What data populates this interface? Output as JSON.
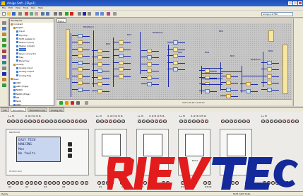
{
  "window": {
    "title": "Amigo Soft - [Elgo1]",
    "controls": [
      "_",
      "□",
      "×"
    ]
  },
  "menu": [
    "File",
    "Edit",
    "View",
    "Tools",
    "Run",
    "Help"
  ],
  "toolbar": {
    "combo_value": "Amigo-12 FBD"
  },
  "tree": {
    "header": "Workspace",
    "items": [
      {
        "label": "Constant",
        "level": 0,
        "color": "#c08a2a"
      },
      {
        "label": "Digital",
        "level": 1,
        "color": "#c08a2a"
      },
      {
        "label": "Input",
        "level": 2,
        "color": "#3f7ad0"
      },
      {
        "label": "Flip flop",
        "level": 2,
        "color": "#3f7ad0"
      },
      {
        "label": "Shift register In",
        "level": 2,
        "color": "#3f7ad0"
      },
      {
        "label": "Status 0 (low)",
        "level": 2,
        "color": "#3f7ad0"
      },
      {
        "label": "Status 1 (high)",
        "level": 2,
        "color": "#3f7ad0"
      },
      {
        "label": "Output",
        "level": 2,
        "color": "#3f7ad0"
      },
      {
        "label": "Open connector",
        "level": 2,
        "color": "#3f7ad0"
      },
      {
        "label": "Flag",
        "level": 2,
        "color": "#3f7ad0"
      },
      {
        "label": "Panel Key",
        "level": 2,
        "color": "#3f7ad0"
      },
      {
        "label": "Analog",
        "level": 1,
        "color": "#c08a2a"
      },
      {
        "label": "Analog input",
        "level": 2,
        "color": "#3f7ad0"
      },
      {
        "label": "Analog output",
        "level": 2,
        "color": "#3f7ad0"
      },
      {
        "label": "Analog flag",
        "level": 2,
        "color": "#3f7ad0"
      },
      {
        "label": "Basic",
        "level": 0,
        "color": "#c08a2a"
      },
      {
        "label": "AND",
        "level": 1,
        "color": "#3f7ad0"
      },
      {
        "label": "AND (Edge)",
        "level": 1,
        "color": "#3f7ad0"
      },
      {
        "label": "NAND",
        "level": 1,
        "color": "#3f7ad0"
      },
      {
        "label": "NAND (Edge)",
        "level": 1,
        "color": "#3f7ad0"
      },
      {
        "label": "OR",
        "level": 1,
        "color": "#3f7ad0"
      },
      {
        "label": "NOR",
        "level": 1,
        "color": "#3f7ad0"
      },
      {
        "label": "XOR",
        "level": 1,
        "color": "#3f7ad0"
      }
    ],
    "selected_index": 7
  },
  "document": {
    "tab": "Elgo1"
  },
  "diagram": {
    "labels": [
      "B001(Block)",
      "B002",
      "B003",
      "B004(Block)",
      "B005",
      "B006",
      "B007",
      "B008(Block)",
      "B009",
      "B010"
    ],
    "io_labels": [
      "I1",
      "I2",
      "I3",
      "I4",
      "Q1",
      "Q2",
      "Q3",
      "Q4"
    ]
  },
  "simbar": {
    "time_text": "2013-09-18 11:06:51"
  },
  "bottom_tabs": [
    "Info",
    "Simulation",
    "Simulation (AI)",
    "Analog (AI)"
  ],
  "simulation": {
    "cpu_brand": "RIEVTECH",
    "lcd_lines": [
      "EASY TECH",
      "NANJING",
      "Mon",
      "No faults"
    ],
    "cpu_model": "PR-18DC-DA-R",
    "ext_modules": [
      "Ext 1",
      "Ext 2",
      "Ext 3",
      "Ext 4"
    ],
    "top_io_labels": [
      "L+ M",
      "I1 I2 I3 I4 I5 I6",
      "L+ M",
      "I1 I2 I3 I4 I5 I6",
      "L+ M",
      "I1 I2 I3 I4 I5 I6",
      "L+ M",
      "I1 I2 I3 I4 I5 I6",
      "L+ M"
    ],
    "bottom_io_labels": [
      "Q1",
      "Q2",
      "Q3",
      "Q4",
      "Q1",
      "Q2",
      "Q3",
      "Q4",
      "Q1 Q2",
      "Q3 Q4"
    ]
  },
  "status": {
    "left": "Ready",
    "right": "NUM  CAPS  SCRL"
  },
  "logo": {
    "text": "RIEVTECH",
    "colors": {
      "red": "#e21c1c",
      "blue": "#142a9a"
    }
  }
}
